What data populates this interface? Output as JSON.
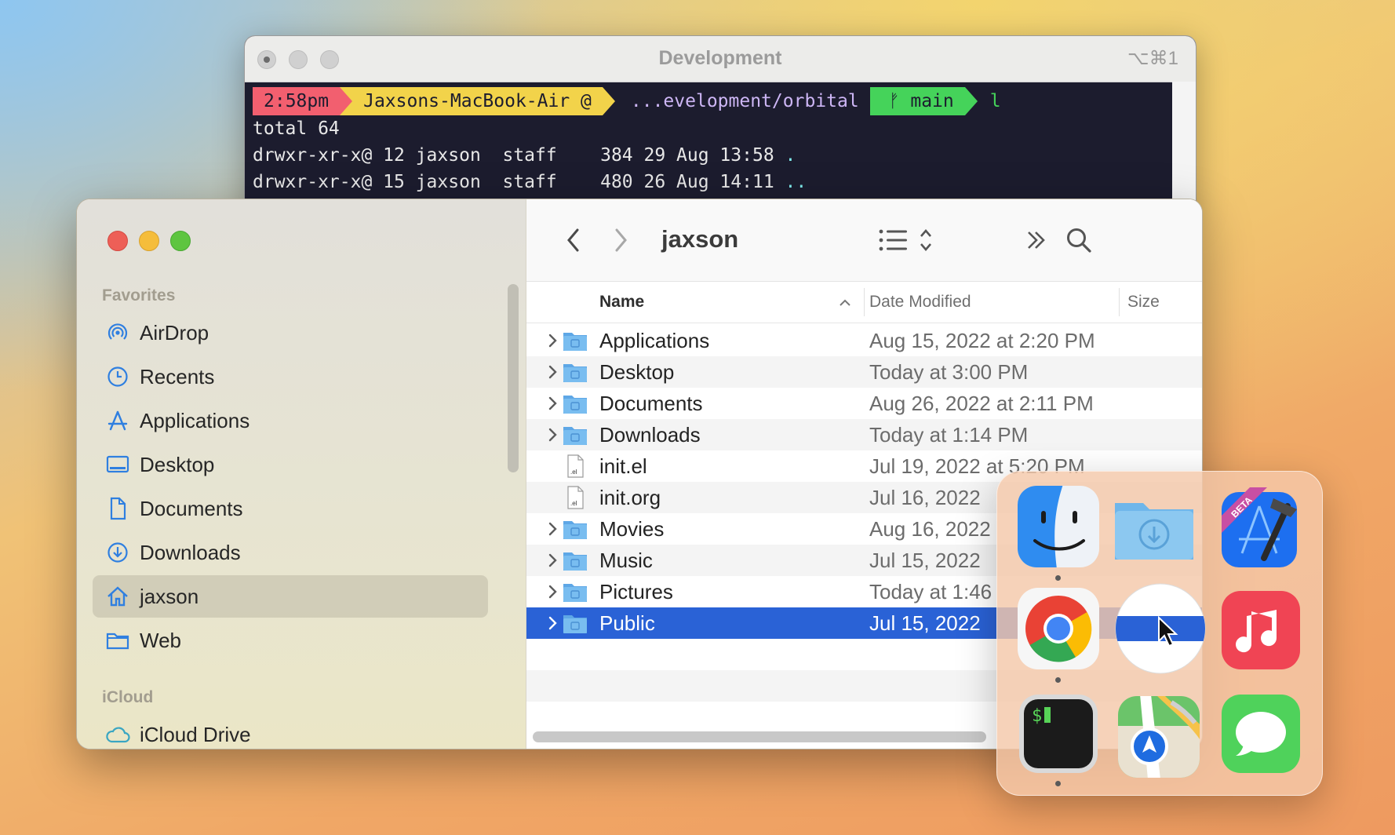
{
  "terminal": {
    "title": "Development",
    "shortcut": "⌥⌘1",
    "prompt": {
      "time": "2:58pm",
      "host": "Jaxsons-MacBook-Air @",
      "path": "...evelopment/orbital",
      "branch_icon": "git-branch-icon",
      "branch": "main",
      "command": "l"
    },
    "lines": [
      {
        "text": "total 64",
        "suffix": ""
      },
      {
        "text": "drwxr-xr-x@ 12 jaxson  staff    384 29 Aug 13:58 ",
        "suffix": "."
      },
      {
        "text": "drwxr-xr-x@ 15 jaxson  staff    480 26 Aug 14:11 ",
        "suffix": ".."
      }
    ]
  },
  "finder": {
    "title": "jaxson",
    "sidebar": {
      "sections": [
        {
          "label": "Favorites"
        },
        {
          "label": "iCloud"
        }
      ],
      "items": [
        {
          "label": "AirDrop",
          "icon": "airdrop-icon"
        },
        {
          "label": "Recents",
          "icon": "clock-icon"
        },
        {
          "label": "Applications",
          "icon": "applications-icon"
        },
        {
          "label": "Desktop",
          "icon": "desktop-icon"
        },
        {
          "label": "Documents",
          "icon": "document-icon"
        },
        {
          "label": "Downloads",
          "icon": "download-icon"
        },
        {
          "label": "jaxson",
          "icon": "home-icon",
          "selected": true
        },
        {
          "label": "Web",
          "icon": "folder-icon"
        },
        {
          "label": "iCloud Drive",
          "icon": "cloud-icon"
        }
      ]
    },
    "columns": {
      "name": "Name",
      "date": "Date Modified",
      "size": "Size"
    },
    "rows": [
      {
        "name": "Applications",
        "date": "Aug 15, 2022 at 2:20 PM",
        "type": "folder"
      },
      {
        "name": "Desktop",
        "date": "Today at 3:00 PM",
        "type": "folder"
      },
      {
        "name": "Documents",
        "date": "Aug 26, 2022 at 2:11 PM",
        "type": "folder"
      },
      {
        "name": "Downloads",
        "date": "Today at 1:14 PM",
        "type": "folder"
      },
      {
        "name": "init.el",
        "date": "Jul 19, 2022 at 5:20 PM",
        "type": "file"
      },
      {
        "name": "init.org",
        "date": "Jul 16, 2022",
        "type": "file"
      },
      {
        "name": "Movies",
        "date": "Aug 16, 2022",
        "type": "folder"
      },
      {
        "name": "Music",
        "date": "Jul 15, 2022",
        "type": "folder"
      },
      {
        "name": "Pictures",
        "date": "Today at 1:46",
        "type": "folder"
      },
      {
        "name": "Public",
        "date": "Jul 15, 2022",
        "type": "folder",
        "selected": true
      }
    ]
  },
  "switcher": {
    "apps": [
      {
        "name": "finder-app-icon",
        "running": true
      },
      {
        "name": "downloads-folder-app-icon",
        "running": false
      },
      {
        "name": "xcode-beta-app-icon",
        "running": false
      },
      {
        "name": "chrome-app-icon",
        "running": true
      },
      {
        "name": "orbital-app-icon",
        "running": false
      },
      {
        "name": "music-app-icon",
        "running": false
      },
      {
        "name": "terminal-app-icon",
        "running": true
      },
      {
        "name": "maps-app-icon",
        "running": false
      },
      {
        "name": "messages-app-icon",
        "running": false
      }
    ]
  },
  "colors": {
    "accent": "#2a62d6",
    "prompt_time": "#f25f6f",
    "prompt_host": "#f2d34a",
    "prompt_git": "#45d35a"
  }
}
